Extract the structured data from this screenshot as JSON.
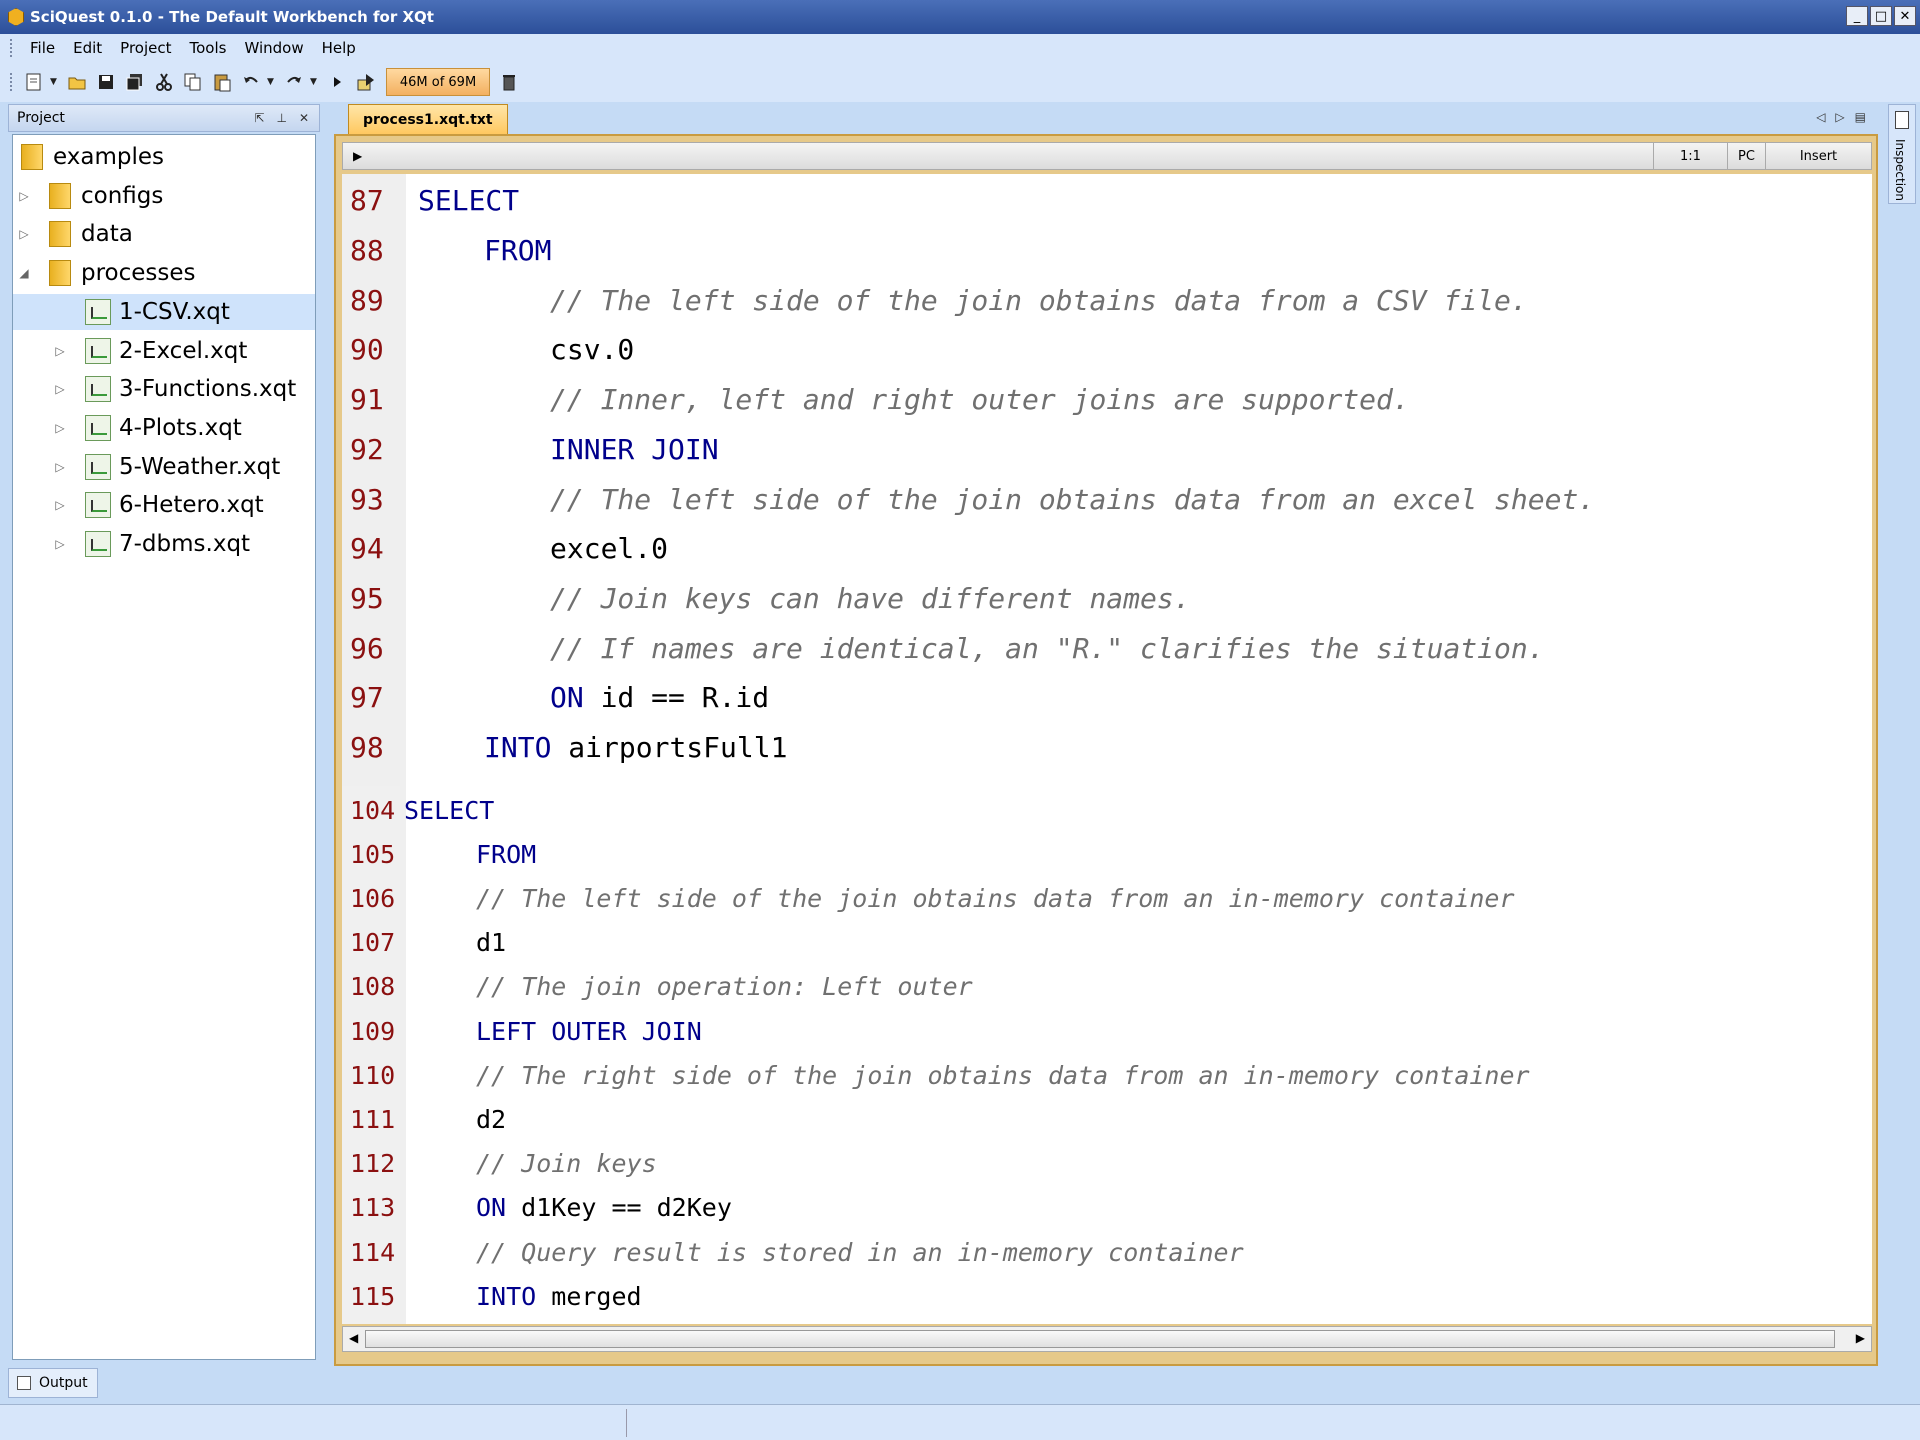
{
  "window": {
    "title": "SciQuest 0.1.0 - The Default Workbench for XQt",
    "controls": [
      "_",
      "□",
      "✕"
    ]
  },
  "menu": [
    "File",
    "Edit",
    "Project",
    "Tools",
    "Window",
    "Help"
  ],
  "toolbar": {
    "memory": "46M of 69M"
  },
  "project_panel": {
    "title": "Project",
    "tree": [
      {
        "label": "examples",
        "type": "folder",
        "level": 0,
        "expander": ""
      },
      {
        "label": "configs",
        "type": "folder",
        "level": 1,
        "expander": "▷"
      },
      {
        "label": "data",
        "type": "folder",
        "level": 1,
        "expander": "▷"
      },
      {
        "label": "processes",
        "type": "folder",
        "level": 1,
        "expander": "◢"
      },
      {
        "label": "1-CSV.xqt",
        "type": "file",
        "level": 2,
        "expander": "",
        "selected": true
      },
      {
        "label": "2-Excel.xqt",
        "type": "file",
        "level": 2,
        "expander": "▷"
      },
      {
        "label": "3-Functions.xqt",
        "type": "file",
        "level": 2,
        "expander": "▷"
      },
      {
        "label": "4-Plots.xqt",
        "type": "file",
        "level": 2,
        "expander": "▷"
      },
      {
        "label": "5-Weather.xqt",
        "type": "file",
        "level": 2,
        "expander": "▷"
      },
      {
        "label": "6-Hetero.xqt",
        "type": "file",
        "level": 2,
        "expander": "▷"
      },
      {
        "label": "7-dbms.xqt",
        "type": "file",
        "level": 2,
        "expander": "▷"
      }
    ]
  },
  "editor": {
    "tab_label": "process1.xqt.txt",
    "status": {
      "position": "1:1",
      "line_ending": "PC",
      "mode": "Insert"
    },
    "block1": [
      {
        "num": "87",
        "indent": 0,
        "parts": [
          [
            "kw",
            "SELECT"
          ]
        ]
      },
      {
        "num": "88",
        "indent": 1,
        "parts": [
          [
            "kw",
            "FROM"
          ]
        ]
      },
      {
        "num": "89",
        "indent": 2,
        "parts": [
          [
            "cm",
            "// The left side of the join obtains data from a CSV file."
          ]
        ]
      },
      {
        "num": "90",
        "indent": 2,
        "parts": [
          [
            "tx",
            "csv.0"
          ]
        ]
      },
      {
        "num": "91",
        "indent": 2,
        "parts": [
          [
            "cm",
            "// Inner, left and right outer joins are supported."
          ]
        ]
      },
      {
        "num": "92",
        "indent": 2,
        "parts": [
          [
            "kw",
            "INNER JOIN"
          ]
        ]
      },
      {
        "num": "93",
        "indent": 2,
        "parts": [
          [
            "cm",
            "// The left side of the join obtains data from an excel sheet."
          ]
        ]
      },
      {
        "num": "94",
        "indent": 2,
        "parts": [
          [
            "tx",
            "excel.0"
          ]
        ]
      },
      {
        "num": "95",
        "indent": 2,
        "parts": [
          [
            "cm",
            "// Join keys can have different names."
          ]
        ]
      },
      {
        "num": "96",
        "indent": 2,
        "parts": [
          [
            "cm",
            "// If names are identical, an \"R.\" clarifies the situation."
          ]
        ]
      },
      {
        "num": "97",
        "indent": 2,
        "parts": [
          [
            "kw",
            "ON"
          ],
          [
            "tx",
            " id == R.id"
          ]
        ]
      },
      {
        "num": "98",
        "indent": 1,
        "parts": [
          [
            "kw",
            "INTO"
          ],
          [
            "tx",
            " airportsFull1"
          ]
        ]
      }
    ],
    "block2": [
      {
        "num": "104",
        "indent": 0,
        "parts": [
          [
            "kw",
            "SELECT"
          ]
        ]
      },
      {
        "num": "105",
        "indent": 1,
        "parts": [
          [
            "kw",
            "FROM"
          ]
        ]
      },
      {
        "num": "106",
        "indent": 1,
        "parts": [
          [
            "cm",
            "// The left side of the join obtains data from an in-memory container"
          ]
        ]
      },
      {
        "num": "107",
        "indent": 1,
        "parts": [
          [
            "tx",
            "d1"
          ]
        ]
      },
      {
        "num": "108",
        "indent": 1,
        "parts": [
          [
            "cm",
            "// The join operation: Left outer"
          ]
        ]
      },
      {
        "num": "109",
        "indent": 1,
        "parts": [
          [
            "kw",
            "LEFT OUTER JOIN"
          ]
        ]
      },
      {
        "num": "110",
        "indent": 1,
        "parts": [
          [
            "cm",
            "// The right side of the join obtains data from an in-memory container"
          ]
        ]
      },
      {
        "num": "111",
        "indent": 1,
        "parts": [
          [
            "tx",
            "d2"
          ]
        ]
      },
      {
        "num": "112",
        "indent": 1,
        "parts": [
          [
            "cm",
            "// Join keys"
          ]
        ]
      },
      {
        "num": "113",
        "indent": 1,
        "parts": [
          [
            "kw",
            "ON"
          ],
          [
            "tx",
            " d1Key == d2Key"
          ]
        ]
      },
      {
        "num": "114",
        "indent": 1,
        "parts": [
          [
            "cm",
            "// Query result is stored in an in-memory container"
          ]
        ]
      },
      {
        "num": "115",
        "indent": 1,
        "parts": [
          [
            "kw",
            "INTO"
          ],
          [
            "tx",
            " merged"
          ]
        ]
      }
    ]
  },
  "side_panel": {
    "label": "Inspection"
  },
  "bottom": {
    "output_tab": "Output"
  }
}
